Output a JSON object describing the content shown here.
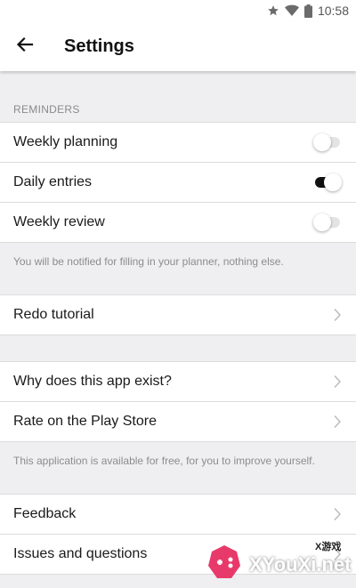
{
  "status_bar": {
    "time": "10:58",
    "icons": [
      "star-icon",
      "wifi-icon",
      "battery-icon"
    ]
  },
  "app_bar": {
    "title": "Settings",
    "back_icon": "arrow-left-icon"
  },
  "reminders": {
    "header": "REMINDERS",
    "items": [
      {
        "label": "Weekly planning",
        "enabled": false
      },
      {
        "label": "Daily entries",
        "enabled": true
      },
      {
        "label": "Weekly review",
        "enabled": false
      }
    ],
    "note": "You will be notified for filling in your planner, nothing else."
  },
  "tutorial": {
    "label": "Redo tutorial"
  },
  "about": {
    "items": [
      {
        "label": "Why does this app exist?"
      },
      {
        "label": "Rate on the Play Store"
      }
    ],
    "note": "This application is available for free, for you to improve yourself."
  },
  "support": {
    "items": [
      {
        "label": "Feedback"
      },
      {
        "label": "Issues and questions"
      }
    ]
  },
  "watermark": {
    "text": "XYouXi.net",
    "sub": "X游戏"
  },
  "colors": {
    "background": "#efeff1",
    "surface": "#ffffff",
    "toggle_on": "#111111",
    "toggle_off": "#e4e4e4",
    "muted_text": "#8c8c8c"
  }
}
